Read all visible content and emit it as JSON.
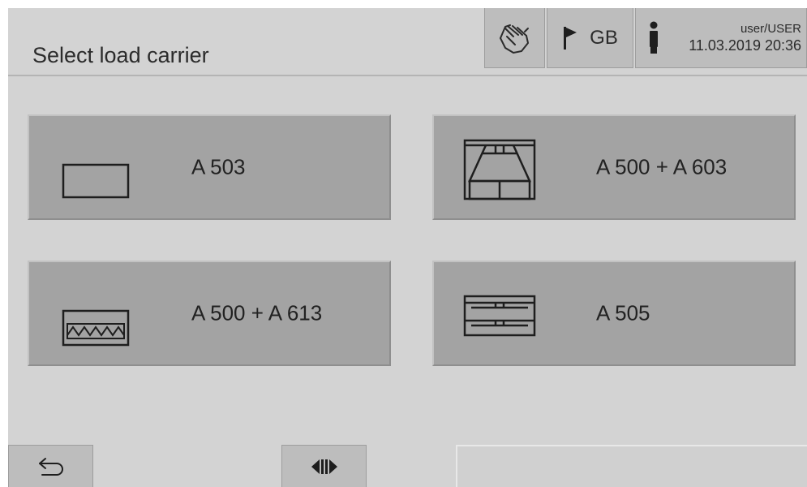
{
  "header": {
    "title": "Select load carrier",
    "language": "GB",
    "user": "user/USER",
    "datetime": "11.03.2019  20:36",
    "icons": {
      "hand": "hand-touch-icon",
      "flag": "flag-icon",
      "person": "person-info-icon"
    }
  },
  "carriers": [
    {
      "label": "A 503",
      "icon": "rectangle-carrier-icon"
    },
    {
      "label": "A 500 + A 603",
      "icon": "trapezoid-carrier-icon"
    },
    {
      "label": "A 500 + A 613",
      "icon": "zigzag-carrier-icon"
    },
    {
      "label": "A 505",
      "icon": "two-level-carrier-icon"
    }
  ],
  "footer": {
    "back_icon": "back-arrow-icon",
    "middle_icon": "play-pause-toggle-icon"
  }
}
